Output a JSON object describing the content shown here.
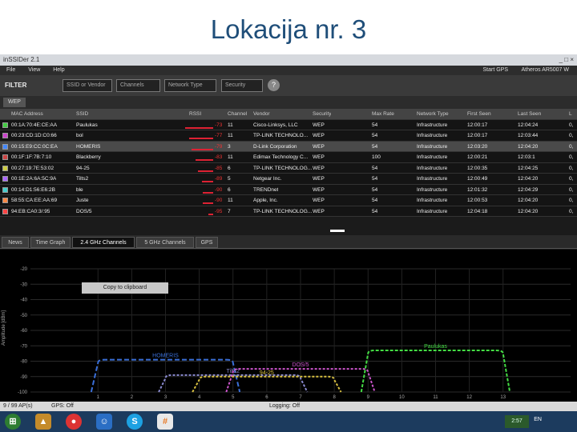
{
  "slide_title": "Lokacija nr. 3",
  "window": {
    "title": "inSSIDer 2.1",
    "controls": "_ □ ×"
  },
  "menu": {
    "items": [
      "File",
      "View",
      "Help"
    ],
    "gps_label": "Start GPS",
    "adapter_label": "Atheros AR5007 W"
  },
  "filter": {
    "label": "FILTER",
    "ssid_placeholder": "SSID or Vendor",
    "channels": "Channels",
    "network_type": "Network Type",
    "security": "Security",
    "help": "?"
  },
  "active_filter": "WEP",
  "table": {
    "headers": [
      "MAC Address",
      "SSID",
      "RSSI",
      "Channel",
      "Vendor",
      "Security",
      "Max Rate",
      "Network Type",
      "First Seen",
      "Last Seen",
      "L"
    ],
    "rows": [
      {
        "mac": "00:1A:70:4E:CE:AA",
        "ssid": "Paulukas",
        "rssi": "-73",
        "channel": "11",
        "vendor": "Cisco-Linksys, LLC",
        "security": "WEP",
        "rate": "54",
        "type": "Infrastructure",
        "first": "12:00:17",
        "last": "12:04:24",
        "extra": "0,"
      },
      {
        "mac": "00:23:CD:1D:C0:66",
        "ssid": "bol",
        "rssi": "-77",
        "channel": "11",
        "vendor": "TP-LINK TECHNOLO...",
        "security": "WEP",
        "rate": "54",
        "type": "Infrastructure",
        "first": "12:00:17",
        "last": "12:03:44",
        "extra": "0,"
      },
      {
        "mac": "00:15:E9:CC:0C:EA",
        "ssid": "HOMERIS",
        "rssi": "-79",
        "channel": "3",
        "vendor": "D-Link Corporation",
        "security": "WEP",
        "rate": "54",
        "type": "Infrastructure",
        "first": "12:03:20",
        "last": "12:04:20",
        "extra": "0,"
      },
      {
        "mac": "00:1F:1F:7B:7:10",
        "ssid": "Blackberry",
        "rssi": "-83",
        "channel": "11",
        "vendor": "Edimax Technology C...",
        "security": "WEP",
        "rate": "100",
        "type": "Infrastructure",
        "first": "12:00:21",
        "last": "12:03:1",
        "extra": "0,"
      },
      {
        "mac": "00:27:19:7E:53:02",
        "ssid": "94-25",
        "rssi": "-85",
        "channel": "6",
        "vendor": "TP-LINK TECHNOLOG...",
        "security": "WEP",
        "rate": "54",
        "type": "Infrastructure",
        "first": "12:00:35",
        "last": "12:04:25",
        "extra": "0,"
      },
      {
        "mac": "00:1E:2A:6A:5C:9A",
        "ssid": "Tilts2",
        "rssi": "-89",
        "channel": "5",
        "vendor": "Netgear Inc.",
        "security": "WEP",
        "rate": "54",
        "type": "Infrastructure",
        "first": "12:00:49",
        "last": "12:04:20",
        "extra": "0,"
      },
      {
        "mac": "00:14:D1:56:E6:2B",
        "ssid": "ble",
        "rssi": "-90",
        "channel": "6",
        "vendor": "TRENDnet",
        "security": "WEP",
        "rate": "54",
        "type": "Infrastructure",
        "first": "12:01:32",
        "last": "12:04:29",
        "extra": "0,"
      },
      {
        "mac": "58:55:CA:EE:AA:69",
        "ssid": "Juste",
        "rssi": "-90",
        "channel": "11",
        "vendor": "Apple, Inc.",
        "security": "WEP",
        "rate": "54",
        "type": "Infrastructure",
        "first": "12:00:53",
        "last": "12:04:20",
        "extra": "0,"
      },
      {
        "mac": "94:EB:CA0:3/:95",
        "ssid": "DOS/5",
        "rssi": "-95",
        "channel": "7",
        "vendor": "TP-LINK TECHNOLOG...",
        "security": "WEP",
        "rate": "54",
        "type": "Infrastructure",
        "first": "12:04:18",
        "last": "12:04:20",
        "extra": "0,"
      }
    ]
  },
  "tabs": [
    "News",
    "Time Graph",
    "2.4 GHz Channels",
    "5 GHz Channels",
    "GPS"
  ],
  "active_tab": "2.4 GHz Channels",
  "copy_button": "Copy to clipboard",
  "chart_data": {
    "type": "area",
    "ylabel": "Amplitude [dBm]",
    "y_ticks": [
      "-20",
      "-30",
      "-40",
      "-50",
      "-60",
      "-70",
      "-80",
      "-90",
      "-100"
    ],
    "x_ticks": [
      "1",
      "2",
      "3",
      "4",
      "5",
      "6",
      "7",
      "8",
      "9",
      "10",
      "11",
      "12",
      "13"
    ],
    "ylim": [
      -100,
      -20
    ],
    "xlim": [
      -1,
      15
    ],
    "series": [
      {
        "name": "HOMERIS",
        "channel": 3,
        "rssi": -79,
        "color": "#3a6fd8",
        "dash": "6,3"
      },
      {
        "name": "Tilts2",
        "channel": 5,
        "rssi": -89,
        "color": "#8a8ad0",
        "dash": "3,2"
      },
      {
        "name": "DOS/5",
        "channel": 7,
        "rssi": -85,
        "color": "#cc55cc",
        "dash": "3,2"
      },
      {
        "name": "94-25",
        "channel": 6,
        "rssi": -90,
        "color": "#d8c040",
        "dash": "3,2"
      },
      {
        "name": "Paulukas",
        "channel": 11,
        "rssi": -73,
        "color": "#44dd44",
        "dash": "4,2"
      }
    ]
  },
  "status": {
    "aps": "9 / 99 AP(s)",
    "gps": "GPS: Off",
    "logging": "Logging: Off"
  },
  "taskbar": {
    "time": "2:57",
    "lang": "EN"
  }
}
